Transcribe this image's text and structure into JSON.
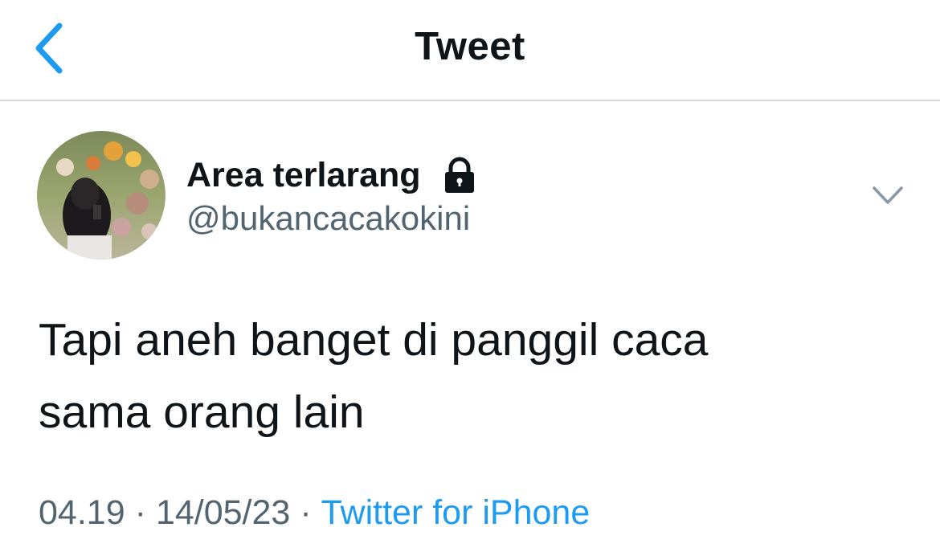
{
  "header": {
    "title": "Tweet",
    "back_icon": "chevron-left-icon",
    "accent_color": "#1d9bf0"
  },
  "author": {
    "display_name": "Area terlarang",
    "handle": "@bukancacakokini",
    "protected_icon": "lock-icon",
    "avatar": "avatar"
  },
  "tweet": {
    "text_lines": [
      "Tapi aneh banget di panggil caca",
      "sama orang lain"
    ],
    "more_icon": "chevron-down-icon"
  },
  "meta": {
    "time": "04.19",
    "separator": "·",
    "date": "14/05/23",
    "source": "Twitter for iPhone"
  },
  "colors": {
    "text_primary": "#0f1419",
    "text_secondary": "#536471",
    "link": "#1d9bf0",
    "divider": "#d4d8dc"
  }
}
